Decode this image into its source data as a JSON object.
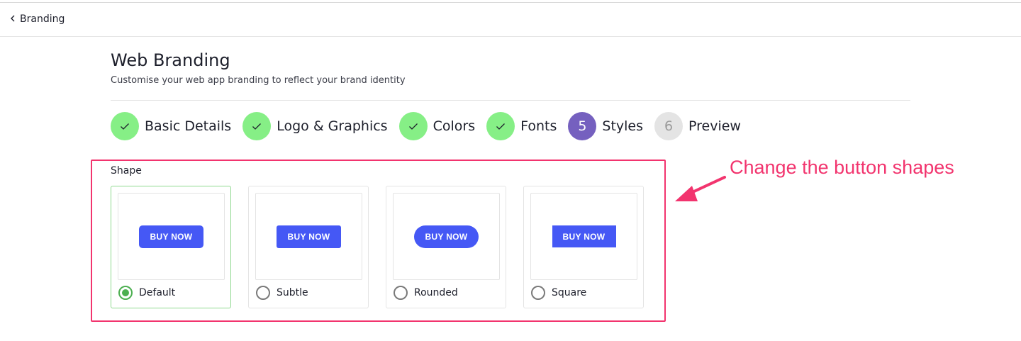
{
  "nav": {
    "back_label": "Branding"
  },
  "header": {
    "title": "Web Branding",
    "subtitle": "Customise your web app branding to reflect your brand identity"
  },
  "steps": [
    {
      "label": "Basic Details",
      "state": "done",
      "number": ""
    },
    {
      "label": "Logo & Graphics",
      "state": "done",
      "number": ""
    },
    {
      "label": "Colors",
      "state": "done",
      "number": ""
    },
    {
      "label": "Fonts",
      "state": "done",
      "number": ""
    },
    {
      "label": "Styles",
      "state": "active",
      "number": "5"
    },
    {
      "label": "Preview",
      "state": "pending",
      "number": "6"
    }
  ],
  "shape": {
    "label": "Shape",
    "selected": "Default",
    "options": [
      {
        "label": "Default",
        "button_text": "BUY NOW",
        "checked": true
      },
      {
        "label": "Subtle",
        "button_text": "BUY NOW",
        "checked": false
      },
      {
        "label": "Rounded",
        "button_text": "BUY NOW",
        "checked": false
      },
      {
        "label": "Square",
        "button_text": "BUY NOW",
        "checked": false
      }
    ]
  },
  "annotation": {
    "text": "Change the button shapes"
  },
  "colors": {
    "step_done": "#86ef86",
    "step_active": "#7560bf",
    "step_pending": "#e4e4e4",
    "button": "#4558f5",
    "radio_checked": "#4caf50",
    "annotation": "#f2346e"
  },
  "icons": {
    "back": "chevron-left-icon",
    "step_done": "check-icon",
    "annotation": "arrow-icon"
  }
}
